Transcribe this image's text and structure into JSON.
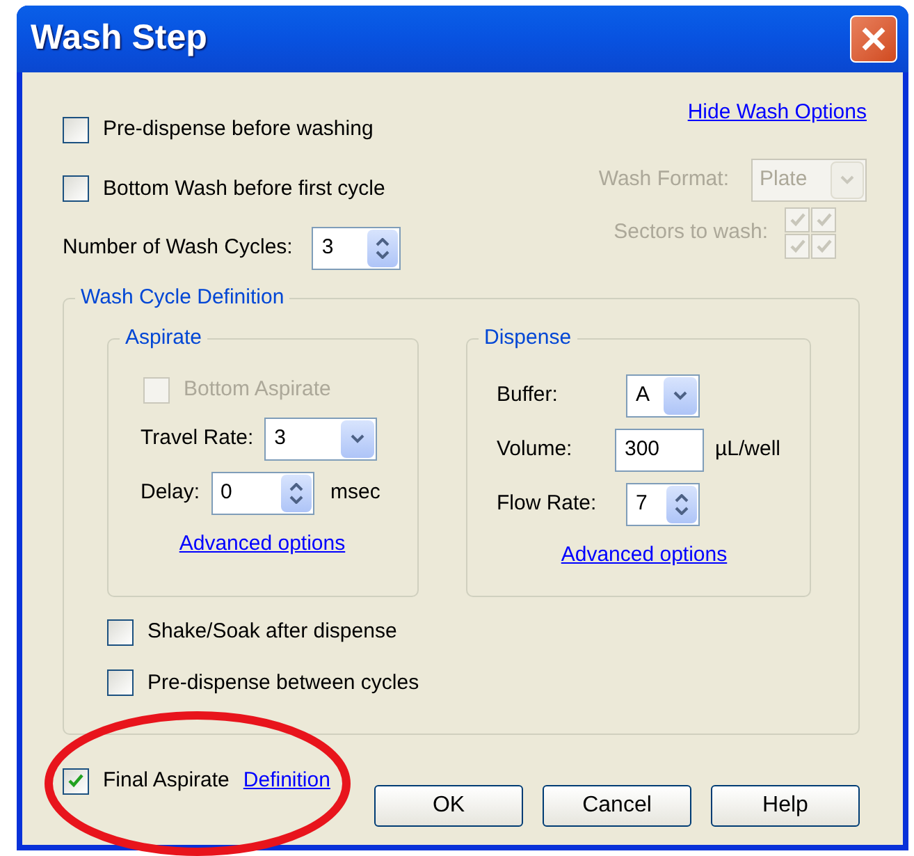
{
  "window": {
    "title": "Wash Step"
  },
  "hide_link": "Hide Wash Options",
  "options": [
    {
      "label": "Pre-dispense before washing",
      "checked": false
    },
    {
      "label": "Bottom Wash before first cycle",
      "checked": false
    }
  ],
  "wash_cycles": {
    "label": "Number of Wash Cycles:",
    "value": "3"
  },
  "wash_format": {
    "label": "Wash Format:",
    "value": "Plate",
    "disabled": true
  },
  "sectors": {
    "label": "Sectors to wash:",
    "disabled": true,
    "cells": [
      {
        "checked": true
      },
      {
        "checked": true
      },
      {
        "checked": true
      },
      {
        "checked": true
      }
    ]
  },
  "cycle_definition": {
    "title": "Wash Cycle Definition",
    "aspirate": {
      "title": "Aspirate",
      "bottom": {
        "label": "Bottom Aspirate",
        "checked": false,
        "disabled": true
      },
      "fields": [
        {
          "kind": "dropdown",
          "label": "Travel Rate:",
          "value": "3"
        },
        {
          "kind": "spin",
          "label": "Delay:",
          "value": "0",
          "unit": "msec"
        }
      ],
      "link": "Advanced options"
    },
    "dispense": {
      "title": "Dispense",
      "fields": [
        {
          "kind": "dropdown",
          "label": "Buffer:",
          "value": "A"
        },
        {
          "kind": "text",
          "label": "Volume:",
          "value": "300",
          "unit": "µL/well"
        },
        {
          "kind": "spin",
          "label": "Flow Rate:",
          "value": "7"
        }
      ],
      "link": "Advanced options"
    },
    "options": [
      {
        "label": "Shake/Soak after dispense",
        "checked": false
      },
      {
        "label": "Pre-dispense between cycles",
        "checked": false
      }
    ]
  },
  "final_aspirate": {
    "label": "Final Aspirate",
    "checked": true,
    "link": "Definition"
  },
  "buttons": [
    "OK",
    "Cancel",
    "Help"
  ]
}
